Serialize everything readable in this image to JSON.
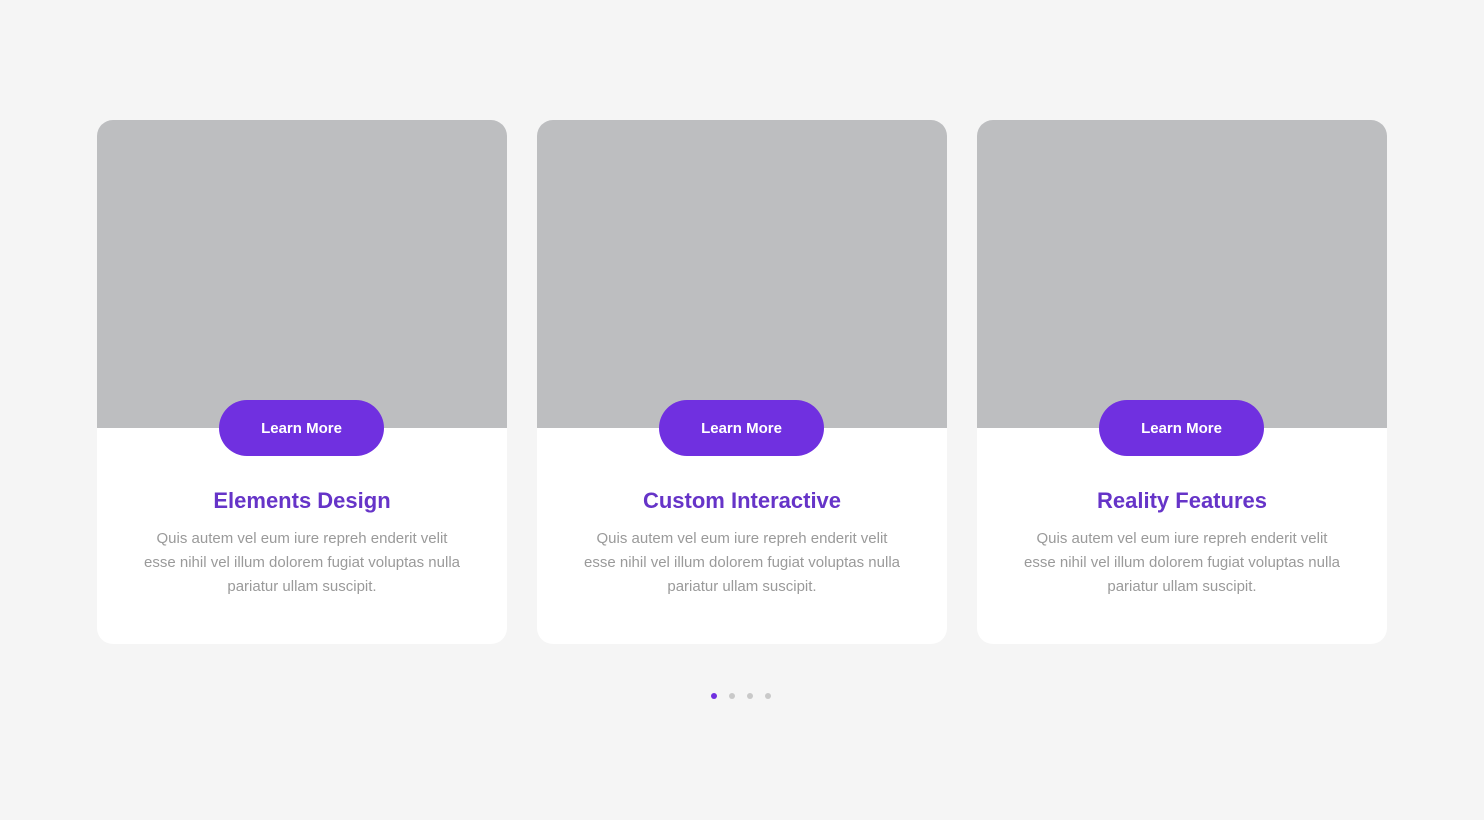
{
  "colors": {
    "background": "#f5f5f5",
    "card": "#ffffff",
    "image_placeholder": "#bdbec0",
    "accent": "#7030e0",
    "title": "#6634c8",
    "body_text": "#9a9a9a",
    "dot_inactive": "#c9c9c9"
  },
  "cards": [
    {
      "button_label": "Learn More",
      "title": "Elements Design",
      "text": "Quis autem vel eum iure repreh enderit velit esse nihil vel illum dolorem fugiat voluptas nulla pariatur ullam suscipit."
    },
    {
      "button_label": "Learn More",
      "title": "Custom Interactive",
      "text": "Quis autem vel eum iure repreh enderit velit esse nihil vel illum dolorem fugiat voluptas nulla pariatur ullam suscipit."
    },
    {
      "button_label": "Learn More",
      "title": "Reality Features",
      "text": "Quis autem vel eum iure repreh enderit velit esse nihil vel illum dolorem fugiat voluptas nulla pariatur ullam suscipit."
    }
  ],
  "pagination": {
    "total_pages": 4,
    "active_page": 1
  }
}
